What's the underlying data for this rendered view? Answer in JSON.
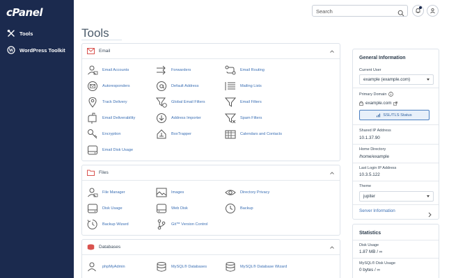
{
  "sidebar": {
    "logo": "cPanel",
    "items": [
      {
        "label": "Tools",
        "icon": "tools-icon"
      },
      {
        "label": "WordPress Toolkit",
        "icon": "wordpress-icon"
      }
    ]
  },
  "topbar": {
    "search_placeholder": "Search",
    "icons": [
      "search-icon",
      "bell-icon",
      "user-icon"
    ]
  },
  "page": {
    "title": "Tools"
  },
  "sections": {
    "email": {
      "title": "Email",
      "tools": [
        "Email Accounts",
        "Forwarders",
        "Email Routing",
        "Autoresponders",
        "Default Address",
        "Mailing Lists",
        "Track Delivery",
        "Global Email Filters",
        "Email Filters",
        "Email Deliverability",
        "Address Importer",
        "Spam Filters",
        "Encryption",
        "BoxTrapper",
        "Calendars and Contacts",
        "Email Disk Usage"
      ]
    },
    "files": {
      "title": "Files",
      "tools": [
        "File Manager",
        "Images",
        "Directory Privacy",
        "Disk Usage",
        "Web Disk",
        "Backup",
        "Backup Wizard",
        "Git™ Version Control"
      ]
    },
    "databases": {
      "title": "Databases",
      "tools": [
        "phpMyAdmin",
        "MySQL® Databases",
        "MySQL® Database Wizard"
      ]
    }
  },
  "general_info": {
    "title": "General Information",
    "current_user_label": "Current User",
    "current_user_value": "example (example.com)",
    "primary_domain_label": "Primary Domain",
    "primary_domain_value": "example.com",
    "ssl_button": "SSL/TLS Status",
    "shared_ip_label": "Shared IP Address",
    "shared_ip_value": "10.1.37.90",
    "home_dir_label": "Home Directory",
    "home_dir_value": "/home/example",
    "last_login_label": "Last Login IP Address",
    "last_login_value": "10.3.5.122",
    "theme_label": "Theme",
    "theme_value": "jupiter",
    "server_info_link": "Server Information"
  },
  "statistics": {
    "title": "Statistics",
    "disk_usage_label": "Disk Usage",
    "disk_usage_value": "1.87 MB / ∞",
    "mysql_disk_label": "MySQL® Disk Usage",
    "mysql_disk_value": "0 bytes / ∞"
  },
  "colors": {
    "sidebar_bg": "#1b2a4e",
    "link": "#3b6fb4",
    "accent_red": "#d9534f"
  }
}
